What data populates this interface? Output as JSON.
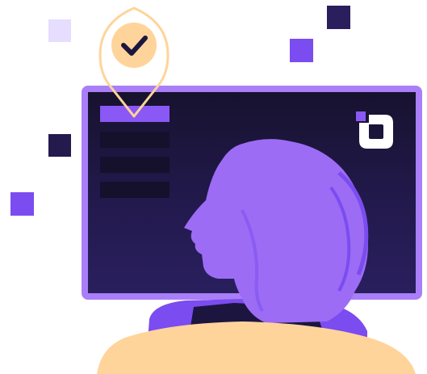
{
  "illustration": {
    "theme": "user profile verification",
    "colors": {
      "accent": "#8a58f5",
      "monitor_frame": "#a97ef8",
      "screen_dark": "#17122f",
      "silhouette": "#9c6cf5",
      "skin_peach": "#ffd49a",
      "dark_square": "#2a1f5c"
    },
    "icons": [
      "check-icon",
      "brand-logo-icon"
    ],
    "menu_items_count": 4,
    "active_menu_item": 0
  }
}
